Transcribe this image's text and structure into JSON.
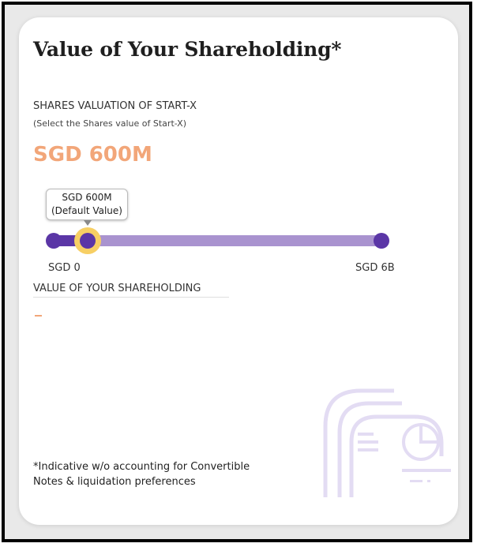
{
  "card": {
    "title": "Value of Your Shareholding*",
    "valuation_label": "SHARES VALUATION OF START-X",
    "valuation_hint": "(Select the Shares value of Start-X)",
    "selected_value": "SGD 600M",
    "slider": {
      "tooltip_value": "SGD 600M",
      "tooltip_note": "(Default Value)",
      "min_label": "SGD 0",
      "max_label": "SGD 6B",
      "fraction": 0.1
    },
    "shareholding_label": "VALUE OF YOUR SHAREHOLDING",
    "shareholding_value": "-",
    "footnote_line1": "*Indicative w/o accounting for Convertible",
    "footnote_line2": "Notes & liquidation preferences"
  },
  "colors": {
    "accent_orange": "#f2a679",
    "slider_purple": "#5b36a6",
    "track_light_purple": "#a993cf",
    "thumb_ring": "#f7cf64",
    "decor_lavender": "#e3dcf3"
  },
  "icons": {
    "decoration": "document-chart-icon"
  }
}
